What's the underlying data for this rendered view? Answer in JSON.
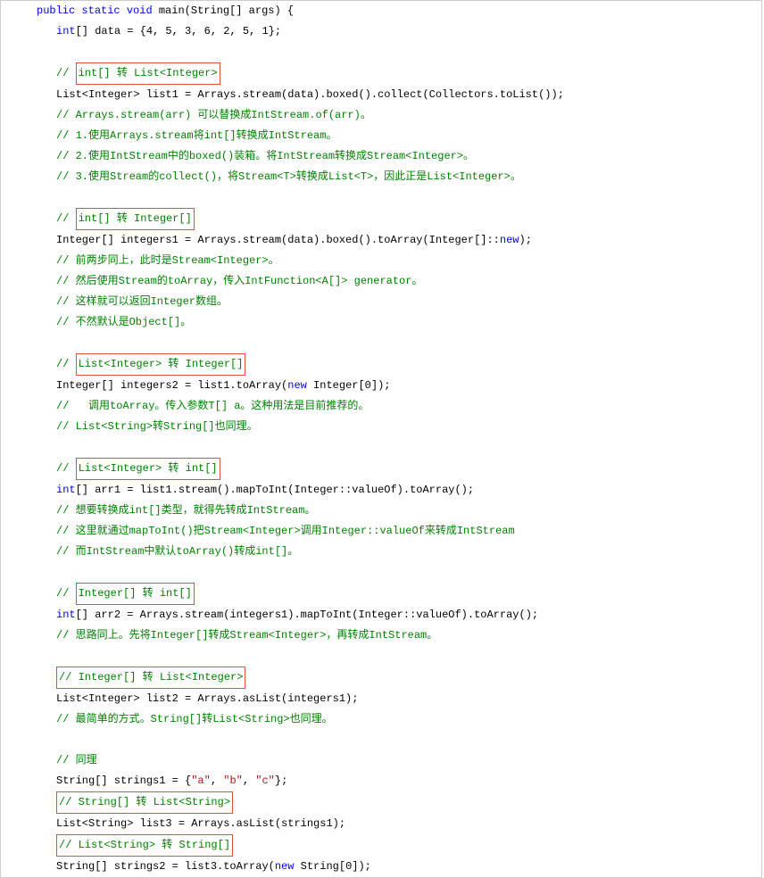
{
  "code": {
    "l1_a": "public",
    "l1_b": " ",
    "l1_c": "static",
    "l1_d": " ",
    "l1_e": "void",
    "l1_f": " main(String[] args) {",
    "l2_a": "int",
    "l2_b": "[] data = {4, 5, 3, 6, 2, 5, 1};",
    "l3": "",
    "l4_a": "// ",
    "l4_b": "int[] 转 List<Integer>",
    "l5": "List<Integer> list1 = Arrays.stream(data).boxed().collect(Collectors.toList());",
    "l6": "// Arrays.stream(arr) 可以替换成IntStream.of(arr)。",
    "l7": "// 1.使用Arrays.stream将int[]转换成IntStream。",
    "l8": "// 2.使用IntStream中的boxed()装箱。将IntStream转换成Stream<Integer>。",
    "l9": "// 3.使用Stream的collect()，将Stream<T>转换成List<T>，因此正是List<Integer>。",
    "l10": "",
    "l11_a": "// ",
    "l11_b": "int[] 转 Integer[]",
    "l12_a": "Integer[] integers1 = Arrays.stream(data).boxed().toArray(Integer[]::",
    "l12_b": "new",
    "l12_c": ");",
    "l13": "// 前两步同上，此时是Stream<Integer>。",
    "l14": "// 然后使用Stream的toArray，传入IntFunction<A[]> generator。",
    "l15": "// 这样就可以返回Integer数组。",
    "l16": "// 不然默认是Object[]。",
    "l17": "",
    "l18_a": "// ",
    "l18_b": "List<Integer> 转 Integer[]",
    "l19_a": "Integer[] integers2 = list1.toArray(",
    "l19_b": "new",
    "l19_c": " Integer[0]);",
    "l20": "//   调用toArray。传入参数T[] a。这种用法是目前推荐的。",
    "l21": "// List<String>转String[]也同理。",
    "l22": "",
    "l23_a": "// ",
    "l23_b": "List<Integer> 转 int[]",
    "l24_a": "int",
    "l24_b": "[] arr1 = list1.stream().mapToInt(Integer::valueOf).toArray();",
    "l25": "// 想要转换成int[]类型，就得先转成IntStream。",
    "l26": "// 这里就通过mapToInt()把Stream<Integer>调用Integer::valueOf来转成IntStream",
    "l27": "// 而IntStream中默认toArray()转成int[]。",
    "l28": "",
    "l29_a": "// ",
    "l29_b": "Integer[] 转 int[]",
    "l30_a": "int",
    "l30_b": "[] arr2 = Arrays.stream(integers1).mapToInt(Integer::valueOf).toArray();",
    "l31": "// 思路同上。先将Integer[]转成Stream<Integer>，再转成IntStream。",
    "l32": "",
    "l33_a": "// Integer[] 转 List<Integer>",
    "l34": "List<Integer> list2 = Arrays.asList(integers1);",
    "l35": "// 最简单的方式。String[]转List<String>也同理。",
    "l36": "",
    "l37": "// 同理",
    "l38_a": "String[] strings1 = {",
    "l38_b": "\"a\"",
    "l38_c": ", ",
    "l38_d": "\"b\"",
    "l38_e": ", ",
    "l38_f": "\"c\"",
    "l38_g": "};",
    "l39_a": "// String[] 转 List<String>",
    "l40": "List<String> list3 = Arrays.asList(strings1);",
    "l41_a": "// List<String> 转 String[]",
    "l42_a": "String[] strings2 = list3.toArray(",
    "l42_b": "new",
    "l42_c": " String[0]);"
  }
}
